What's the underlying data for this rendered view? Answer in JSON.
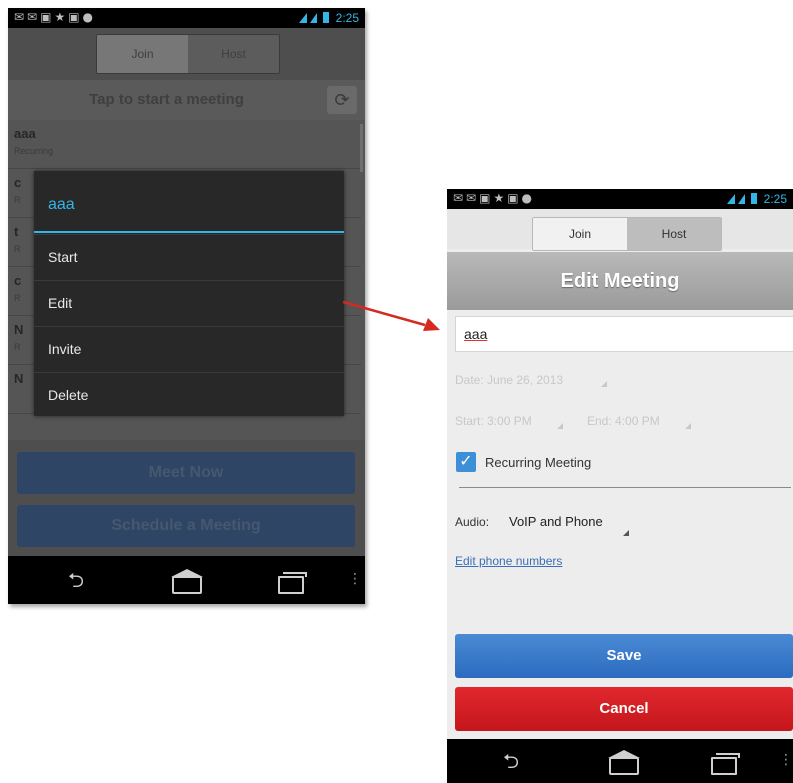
{
  "colors": {
    "accent_blue": "#33b5e5",
    "save_blue": "#2b6cc0",
    "cancel_red": "#d21f24",
    "dialog_bg": "#282828"
  },
  "phone1": {
    "status_time": "2:25",
    "tabs": [
      "Join",
      "Host"
    ],
    "tap_bar": "Tap to start a meeting",
    "meetings": [
      {
        "title": "aaa",
        "subtitle": "Recurring"
      },
      {
        "title": "c",
        "subtitle": "R"
      },
      {
        "title": "t",
        "subtitle": "R"
      },
      {
        "title": "c",
        "subtitle": "R"
      },
      {
        "title": "N",
        "subtitle": "R"
      },
      {
        "title": "N",
        "subtitle": ""
      }
    ],
    "dialog": {
      "title": "aaa",
      "items": [
        "Start",
        "Edit",
        "Invite",
        "Delete"
      ]
    },
    "meet_now": "Meet Now",
    "schedule": "Schedule a Meeting"
  },
  "phone2": {
    "status_time": "2:25",
    "tabs": [
      "Join",
      "Host"
    ],
    "header": "Edit Meeting",
    "title_value": "aaa",
    "date": "Date:  June 26, 2013",
    "start": "Start:  3:00 PM",
    "end": "End:  4:00 PM",
    "recurring_label": "Recurring Meeting",
    "recurring_checked": true,
    "audio_label": "Audio:",
    "audio_value": "VoIP and Phone",
    "edit_phone_link": "Edit phone numbers",
    "save": "Save",
    "cancel": "Cancel"
  }
}
